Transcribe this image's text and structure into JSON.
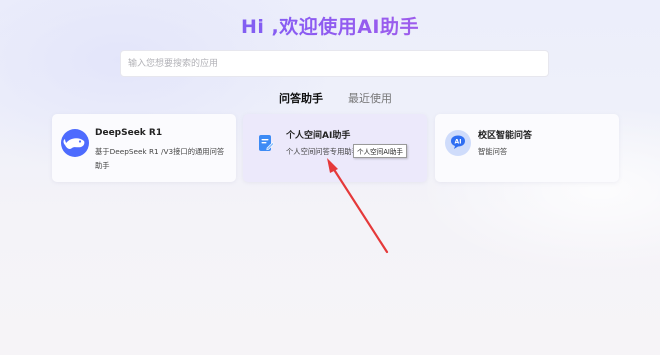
{
  "header": {
    "title": "Hi ,欢迎使用AI助手"
  },
  "search": {
    "placeholder": "输入您想要搜索的应用"
  },
  "tabs": [
    {
      "label": "问答助手",
      "active": true
    },
    {
      "label": "最近使用",
      "active": false
    }
  ],
  "cards": [
    {
      "name": "DeepSeek R1",
      "desc": "基于DeepSeek R1 /V3接口的通用问答助手",
      "icon": "whale-icon"
    },
    {
      "name": "个人空间AI助手",
      "desc": "个人空间问答专用助手",
      "icon": "document-edit-icon"
    },
    {
      "name": "校区智能问答",
      "desc": "智能问答",
      "icon": "ai-chat-icon"
    }
  ],
  "tooltip": {
    "text": "个人空间AI助手"
  },
  "colors": {
    "accent": "#5b6cf0",
    "brand_blue": "#4d6bfe",
    "arrow": "#e5393a"
  }
}
